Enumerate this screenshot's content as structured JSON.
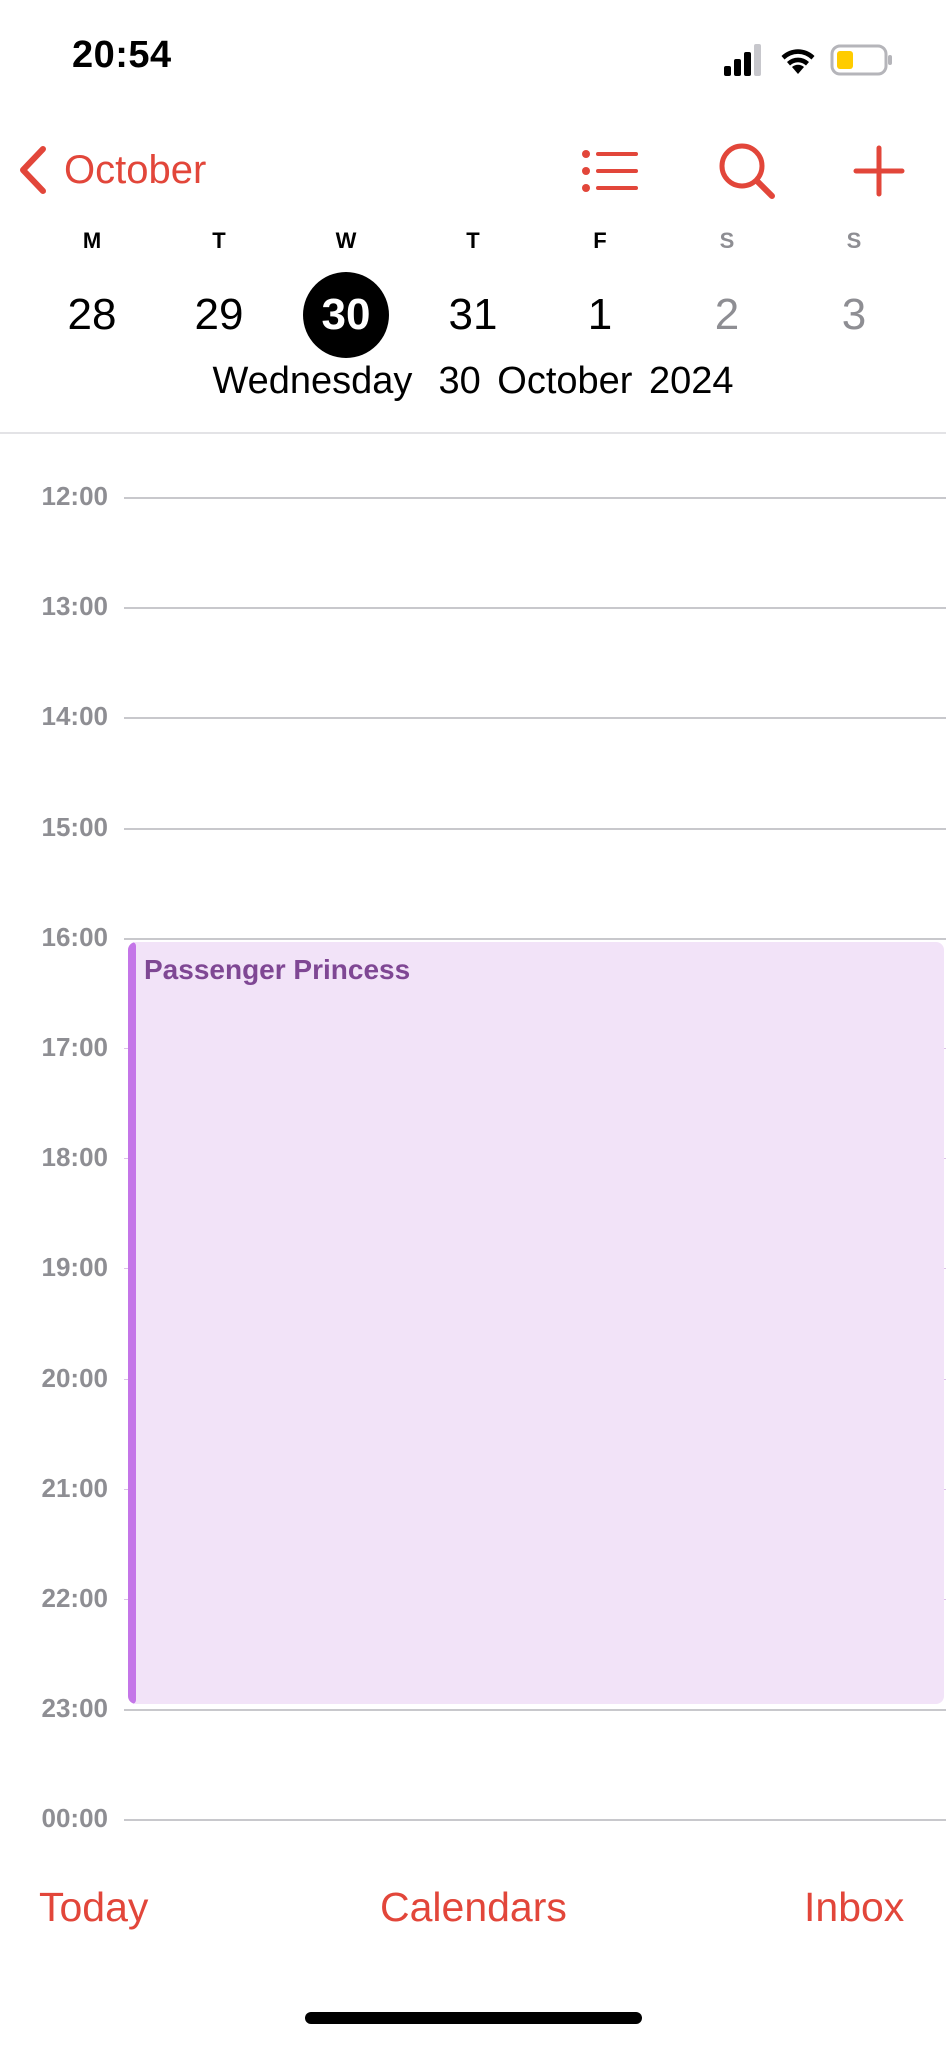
{
  "status_bar": {
    "time": "20:54",
    "icons": [
      "cellular-signal-icon",
      "wifi-icon",
      "battery-icon"
    ],
    "battery_color": "#ffcc00"
  },
  "nav": {
    "back_label": "October",
    "icons": [
      "chevron-left-icon",
      "list-icon",
      "search-icon",
      "plus-icon"
    ],
    "accent_color": "#e2463a"
  },
  "week": {
    "weekdays": [
      "M",
      "T",
      "W",
      "T",
      "F",
      "S",
      "S"
    ],
    "days": [
      "28",
      "29",
      "30",
      "31",
      "1",
      "2",
      "3"
    ],
    "selected_day": "30"
  },
  "date_caption": {
    "weekday": "Wednesday",
    "date": "30 October 2024"
  },
  "timeline": {
    "hours": [
      "12:00",
      "13:00",
      "14:00",
      "15:00",
      "16:00",
      "17:00",
      "18:00",
      "19:00",
      "20:00",
      "21:00",
      "22:00",
      "23:00",
      "00:00"
    ]
  },
  "event": {
    "title": "Passenger Princess",
    "color": "#c476e8",
    "background": "#f2e3f8"
  },
  "toolbar": {
    "today": "Today",
    "calendars": "Calendars",
    "inbox": "Inbox"
  }
}
